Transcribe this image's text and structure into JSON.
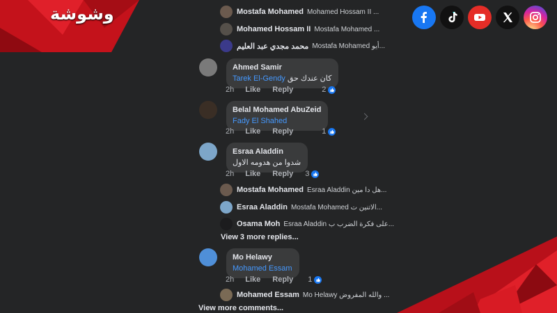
{
  "brand": {
    "logo_text": "وشوشة"
  },
  "socials": [
    {
      "name": "facebook",
      "color": "#1877f2"
    },
    {
      "name": "tiktok",
      "color": "#111111"
    },
    {
      "name": "youtube",
      "color": "#e52d27"
    },
    {
      "name": "x",
      "color": "#111111"
    },
    {
      "name": "instagram",
      "color": "#d6249f"
    }
  ],
  "replies_top": [
    {
      "name": "Mostafa Mohamed",
      "text": "Mohamed Hossam II ..."
    },
    {
      "name": "Mohamed Hossam II",
      "text": "Mostafa Mohamed ..."
    },
    {
      "name": "محمد مجدي عبد العليم",
      "text": "Mostafa Mohamed أيو..."
    }
  ],
  "comments": [
    {
      "name": "Ahmed Samir",
      "tag": "Tarek El-Gendy",
      "text": "كان عندك حق",
      "time": "2h",
      "like": "Like",
      "reply": "Reply",
      "reactions": "2"
    },
    {
      "name": "Belal Mohamed AbuZeid",
      "tag": "Fady El Shahed",
      "text": "",
      "time": "2h",
      "like": "Like",
      "reply": "Reply",
      "reactions": "1"
    },
    {
      "name": "Esraa Aladdin",
      "tag": "",
      "text": "شدوا من هدومه الاول",
      "time": "2h",
      "like": "Like",
      "reply": "Reply",
      "reactions": "3"
    },
    {
      "name": "Mo Helawy",
      "tag": "Mohamed Essam",
      "text": "",
      "time": "2h",
      "like": "Like",
      "reply": "Reply",
      "reactions": "1"
    }
  ],
  "replies_esraa": [
    {
      "name": "Mostafa Mohamed",
      "text": "Esraa Aladdin هل دا مين..."
    },
    {
      "name": "Esraa Aladdin",
      "text": "Mostafa Mohamed الاتنين ت..."
    },
    {
      "name": "Osama Moh",
      "text": "Esraa Aladdin على فكرة الضرب ب..."
    }
  ],
  "view_more_replies": "View 3 more replies...",
  "reply_mo": {
    "name": "Mohamed Essam",
    "text": "Mo Helawy والله المفروض ..."
  },
  "view_more_comments": "View more comments..."
}
